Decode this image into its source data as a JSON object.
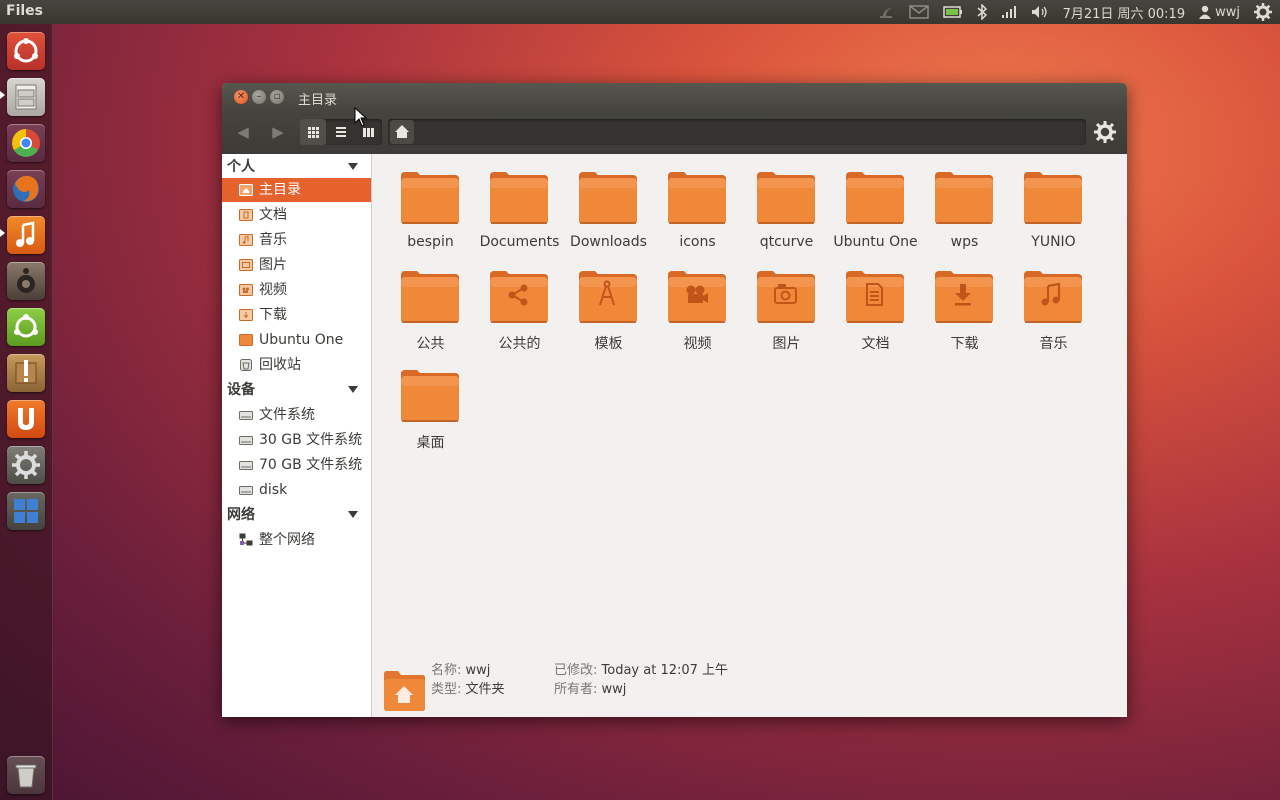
{
  "panel": {
    "app_title": "Files",
    "clock": "7月21日 周六 00:19",
    "user": "wwj"
  },
  "launcher": {
    "items": [
      "dash-home",
      "files",
      "chromium",
      "firefox",
      "music-player",
      "speaker",
      "ubuntu-tweak",
      "package-installer",
      "ubuntu-one",
      "system-settings",
      "workspace-switcher"
    ],
    "trash": "trash"
  },
  "window": {
    "title": "主目录"
  },
  "sidebar": {
    "sections": [
      {
        "title": "个人",
        "items": [
          "主目录",
          "文档",
          "音乐",
          "图片",
          "视频",
          "下载",
          "Ubuntu One",
          "回收站"
        ]
      },
      {
        "title": "设备",
        "items": [
          "文件系统",
          "30 GB 文件系统",
          "70 GB 文件系统",
          "disk"
        ]
      },
      {
        "title": "网络",
        "items": [
          "整个网络"
        ]
      }
    ],
    "selected": "主目录"
  },
  "files": [
    {
      "name": "bespin",
      "emblem": "none"
    },
    {
      "name": "Documents",
      "emblem": "none"
    },
    {
      "name": "Downloads",
      "emblem": "none"
    },
    {
      "name": "icons",
      "emblem": "none"
    },
    {
      "name": "qtcurve",
      "emblem": "none"
    },
    {
      "name": "Ubuntu One",
      "emblem": "none"
    },
    {
      "name": "wps",
      "emblem": "none"
    },
    {
      "name": "YUNIO",
      "emblem": "none"
    },
    {
      "name": "公共",
      "emblem": "none"
    },
    {
      "name": "公共的",
      "emblem": "share"
    },
    {
      "name": "模板",
      "emblem": "compass"
    },
    {
      "name": "视频",
      "emblem": "camera"
    },
    {
      "name": "图片",
      "emblem": "photo"
    },
    {
      "name": "文档",
      "emblem": "document"
    },
    {
      "name": "下载",
      "emblem": "download"
    },
    {
      "name": "音乐",
      "emblem": "music"
    },
    {
      "name": "桌面",
      "emblem": "none"
    }
  ],
  "status": {
    "name_key": "名称:",
    "name_val": "wwj",
    "type_key": "类型:",
    "type_val": "文件夹",
    "modified_key": "已修改:",
    "modified_val": "Today at 12:07 上午",
    "owner_key": "所有者:",
    "owner_val": "wwj"
  },
  "colors": {
    "accent": "#e6622c",
    "folder": "#f0883a"
  }
}
